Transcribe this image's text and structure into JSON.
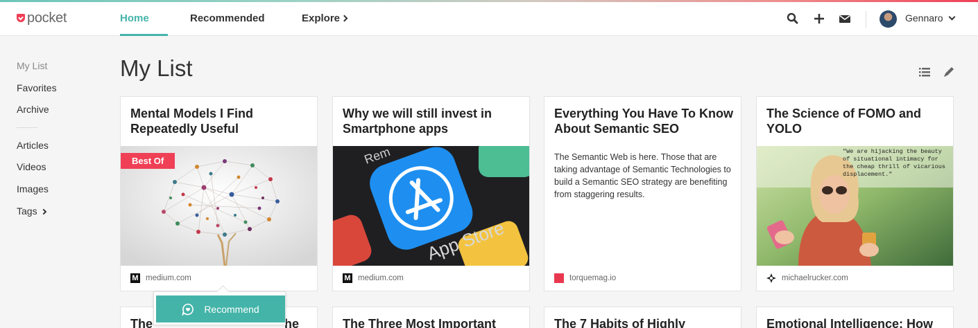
{
  "app": {
    "logo_text": "pocket",
    "brand_color": "#ef4056",
    "accent_color": "#44b4a9"
  },
  "nav": {
    "home": "Home",
    "recommended": "Recommended",
    "explore": "Explore"
  },
  "toolbar": {
    "icons": [
      "search-icon",
      "add-icon",
      "inbox-icon"
    ]
  },
  "user": {
    "name": "Gennaro"
  },
  "sidebar": {
    "items": [
      {
        "label": "My List"
      },
      {
        "label": "Favorites"
      },
      {
        "label": "Archive"
      },
      {
        "label": "Articles"
      },
      {
        "label": "Videos"
      },
      {
        "label": "Images"
      },
      {
        "label": "Tags"
      }
    ]
  },
  "main": {
    "title": "My List"
  },
  "cards": [
    {
      "title": "Mental Models I Find Repeatedly Useful",
      "badge": "Best Of",
      "domain": "medium.com",
      "favicon": "M"
    },
    {
      "title": "Why we will still invest in Smartphone apps",
      "domain": "medium.com",
      "favicon": "M",
      "image_text": [
        "Rem",
        "App Store"
      ]
    },
    {
      "title": "Everything You Have To Know About Semantic SEO",
      "excerpt": "The Semantic Web is here. Those that are taking advantage of Semantic Technologies to build a Semantic SEO strategy are benefiting from staggering results.",
      "domain": "torquemag.io"
    },
    {
      "title": "The Science of FOMO and YOLO",
      "domain": "michaelrucker.com",
      "image_quote": "\"We are hijacking the beauty of situational intimacy for the cheap thrill of vicarious displacement.\""
    }
  ],
  "popover": {
    "recommend_label": "Recommend"
  },
  "row2": [
    {
      "title": "The"
    },
    {
      "title": "he"
    },
    {
      "title": "The Three Most Important"
    },
    {
      "title": "The 7 Habits of Highly"
    },
    {
      "title": "Emotional Intelligence: How"
    }
  ]
}
